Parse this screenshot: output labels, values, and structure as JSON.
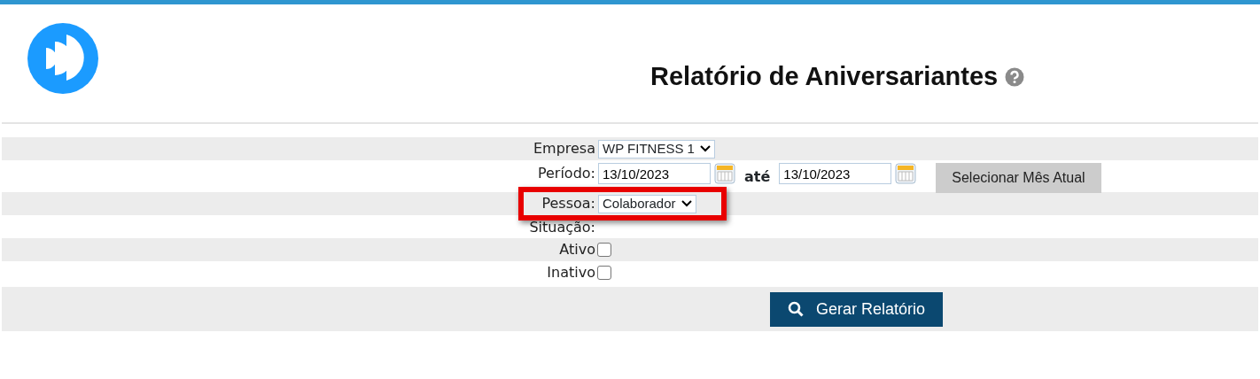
{
  "title": "Relatório de Aniversariantes",
  "form": [
    {
      "kind": "select",
      "label": "Empresa",
      "value": "WP FITNESS 1"
    },
    {
      "kind": "daterange",
      "label": "Período:",
      "from": "13/10/2023",
      "separator": "até",
      "to": "13/10/2023",
      "button": "Selecionar Mês Atual"
    },
    {
      "kind": "select",
      "label": "Pessoa:",
      "value": "Colaborador",
      "highlighted": true
    },
    {
      "kind": "heading",
      "label": "Situação:"
    },
    {
      "kind": "checkbox",
      "label": "Ativo",
      "checked": false
    },
    {
      "kind": "checkbox",
      "label": "Inativo",
      "checked": false
    }
  ],
  "submit": "Gerar Relatório"
}
